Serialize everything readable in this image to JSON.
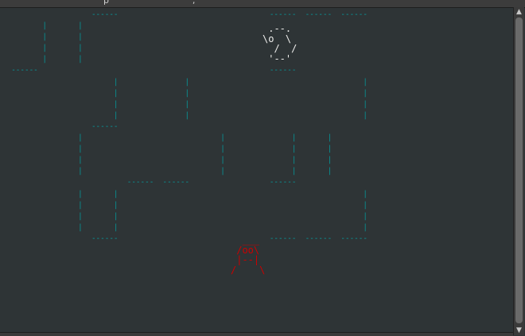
{
  "window": {
    "title_fragment": "p                              ,"
  },
  "terminal": {
    "colors": {
      "background": "#2e3436",
      "maze": "#06989a",
      "ghost": "#eeeeec",
      "player": "#cc0000"
    },
    "maze_rows": [
      "                    ------                                  ------  ------  ------",
      "         |       |",
      "         |       |",
      "         |       |",
      "         |       |",
      "  ------                                                    ------",
      "                         |               |                                       |",
      "                         |               |                                       |",
      "                         |               |                                       |",
      "                         |               |                                       |",
      "                    ------",
      "                 |                               |               |       |",
      "                 |                               |               |       |",
      "                 |                               |               |       |",
      "                 |                               |               |       |",
      "                            ------  ------                  ------",
      "                 |       |                                                       |",
      "                 |       |                                                       |",
      "                 |       |                                                       |",
      "                 |       |                                                       |",
      "                    ------                                  ------  ------  ------"
    ],
    "ghost_sprite": " .--.\n\\o  \\\n  /  /\n '--'",
    "player_sprite": "  ___\n /oo\\\n |--|\n/    \\"
  },
  "scrollbar": {
    "up_icon": "▲",
    "down_icon": "▼",
    "position_fraction": 1.0
  }
}
